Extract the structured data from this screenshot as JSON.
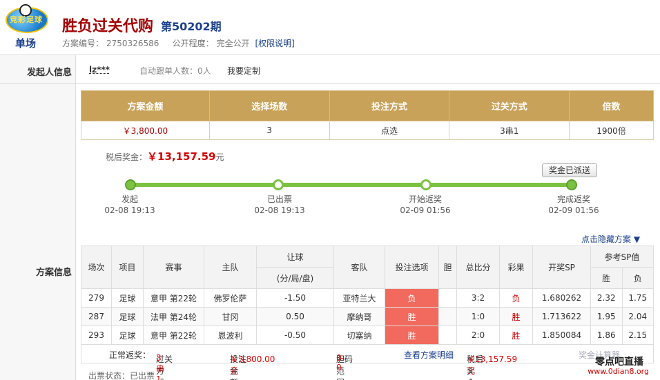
{
  "header": {
    "logo_text": "竞彩足球",
    "logo_sub": "单场",
    "title": "胜负过关代购",
    "issue": "第50202期",
    "plan_no_label": "方案编号：",
    "plan_no": "2750326586",
    "publicity_label": "公开程度：",
    "publicity": "完全公开",
    "permission_link": "[权限说明]"
  },
  "labels": {
    "initiator": "发起人信息",
    "plan_info": "方案信息"
  },
  "initiator": {
    "user": "lz***",
    "auto_follow": "自动跟单人数：0人",
    "custom": "我要定制"
  },
  "summary": {
    "headers": [
      "方案金额",
      "选择场数",
      "投注方式",
      "过关方式",
      "倍数"
    ],
    "values": [
      "￥3,800.00",
      "3",
      "点选",
      "3串1",
      "1900倍"
    ]
  },
  "prize": {
    "label": "税后奖金：",
    "amount": "￥13,157.59",
    "unit": "元",
    "sent_button": "奖金已派送"
  },
  "progress": {
    "steps": [
      {
        "name": "发起",
        "time": "02-08 19:13"
      },
      {
        "name": "已出票",
        "time": "02-08 19:13"
      },
      {
        "name": "开始返奖",
        "time": "02-09 01:56"
      },
      {
        "name": "完成返奖",
        "time": "02-09 01:56"
      }
    ]
  },
  "hide_link": "点击隐藏方案 ▼",
  "matches": {
    "headers": {
      "no": "场次",
      "item": "项目",
      "league": "赛事",
      "home": "主队",
      "handicap": "让球",
      "handicap_sub": "(分/局/盘)",
      "away": "客队",
      "pick": "投注选项",
      "dan": "胆",
      "score": "总比分",
      "result": "彩果",
      "sp": "开奖SP",
      "ref_sp": "参考SP值",
      "win": "胜",
      "lose": "负"
    },
    "rows": [
      {
        "no": "279",
        "item": "足球",
        "league": "意甲 第22轮",
        "home": "佛罗伦萨",
        "handicap": "-1.50",
        "away": "亚特兰大",
        "pick": "负",
        "dan": "",
        "score": "3:2",
        "result": "负",
        "sp": "1.680262",
        "win": "2.32",
        "lose": "1.75"
      },
      {
        "no": "287",
        "item": "足球",
        "league": "法甲 第24轮",
        "home": "甘冈",
        "handicap": "0.50",
        "away": "摩纳哥",
        "pick": "胜",
        "dan": "",
        "score": "1:0",
        "result": "胜",
        "sp": "1.713622",
        "win": "1.95",
        "lose": "2.04"
      },
      {
        "no": "293",
        "item": "足球",
        "league": "意甲 第22轮",
        "home": "恩波利",
        "handicap": "-0.50",
        "away": "切塞纳",
        "pick": "胜",
        "dan": "",
        "score": "2:0",
        "result": "胜",
        "sp": "1.850084",
        "win": "1.86",
        "lose": "2.15"
      }
    ]
  },
  "footer": {
    "normal_return": "正常返奖：",
    "pass_label": "过关方式：",
    "pass_value": "3串1",
    "bet_label": "投注金额：",
    "bet_value": "￥3,800.00元",
    "range_label": "胆码范围：",
    "range_value": "0-0",
    "detail_link": "查看方案明细",
    "tax_label": "税后奖金：",
    "tax_value": "￥13,157.59元",
    "calc": "奖金计算器"
  },
  "status": "出票状态：已出票",
  "watermark": {
    "line1": "零点吧直播",
    "line2": "www.0dian8.org"
  }
}
